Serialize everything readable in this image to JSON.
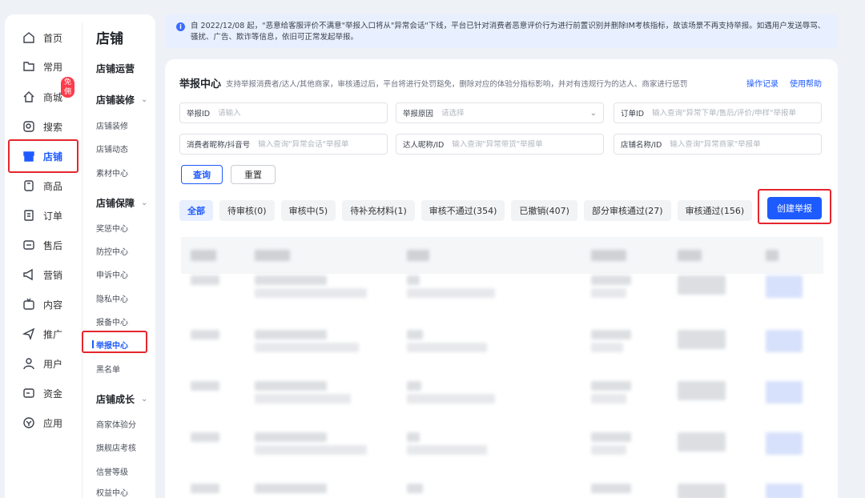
{
  "nav": {
    "items": [
      {
        "key": "home",
        "label": "首页",
        "icon": "home-icon"
      },
      {
        "key": "common",
        "label": "常用",
        "icon": "folder-icon"
      },
      {
        "key": "mall",
        "label": "商城",
        "icon": "store-icon",
        "badge": "免佣"
      },
      {
        "key": "search",
        "label": "搜索",
        "icon": "search-icon"
      },
      {
        "key": "shop",
        "label": "店铺",
        "icon": "shop-icon",
        "active": true
      },
      {
        "key": "goods",
        "label": "商品",
        "icon": "goods-icon"
      },
      {
        "key": "order",
        "label": "订单",
        "icon": "order-icon"
      },
      {
        "key": "aftersale",
        "label": "售后",
        "icon": "aftersale-icon"
      },
      {
        "key": "marketing",
        "label": "营销",
        "icon": "megaphone-icon"
      },
      {
        "key": "content",
        "label": "内容",
        "icon": "tv-icon"
      },
      {
        "key": "promote",
        "label": "推广",
        "icon": "send-icon"
      },
      {
        "key": "user",
        "label": "用户",
        "icon": "user-icon"
      },
      {
        "key": "funds",
        "label": "资金",
        "icon": "wallet-icon"
      },
      {
        "key": "apps",
        "label": "应用",
        "icon": "apps-icon"
      }
    ]
  },
  "submenu": {
    "title": "店铺",
    "groups": [
      {
        "label": "店铺运营",
        "chevron": false
      },
      {
        "label": "店铺装修",
        "chevron": true
      },
      {
        "label": "店铺保障",
        "chevron": true
      },
      {
        "label": "店铺成长",
        "chevron": true
      }
    ],
    "items": {
      "decor": [
        "店铺装修",
        "店铺动态",
        "素材中心"
      ],
      "guarantee": [
        "奖惩中心",
        "防控中心",
        "申诉中心",
        "隐私中心",
        "报备中心",
        "举报中心",
        "黑名单"
      ],
      "growth": [
        "商家体验分",
        "旗舰店考核",
        "信誉等级",
        "权益中心"
      ]
    },
    "active_item": "举报中心"
  },
  "notice": {
    "text": "自 2022/12/08 起，\"恶意给客服评价不满意\"举报入口将从\"异常会话\"下线，平台已针对消费者恶意评价行为进行前置识别并删除IM考核指标，故该场景不再支持举报。如遇用户发送辱骂、骚扰、广告、欺诈等信息，依旧可正常发起举报。"
  },
  "main": {
    "title": "举报中心",
    "description": "支持举报消费者/达人/其他商家，审核通过后，平台将进行处罚豁免，删除对应的体验分指标影响，并对有违规行为的达人、商家进行惩罚",
    "links": [
      "操作记录",
      "使用帮助"
    ],
    "filters": [
      {
        "label": "举报ID",
        "placeholder": "请输入"
      },
      {
        "label": "举报原因",
        "placeholder": "请选择",
        "dropdown": true
      },
      {
        "label": "订单ID",
        "placeholder": "输入查询\"异常下单/售后/评价/申样\"举报单"
      },
      {
        "label": "消费者昵称/抖音号",
        "placeholder": "输入查询\"异常会话\"举报单"
      },
      {
        "label": "达人昵称/ID",
        "placeholder": "输入查询\"异常带货\"举报单"
      },
      {
        "label": "店铺名称/ID",
        "placeholder": "输入查询\"异常商家\"举报单"
      }
    ],
    "query_label": "查询",
    "reset_label": "重置",
    "tabs": [
      "全部",
      "待审核(0)",
      "审核中(5)",
      "待补充材料(1)",
      "审核不通过(354)",
      "已撤销(407)",
      "部分审核通过(27)",
      "审核通过(156)"
    ],
    "create_label": "创建举报"
  }
}
